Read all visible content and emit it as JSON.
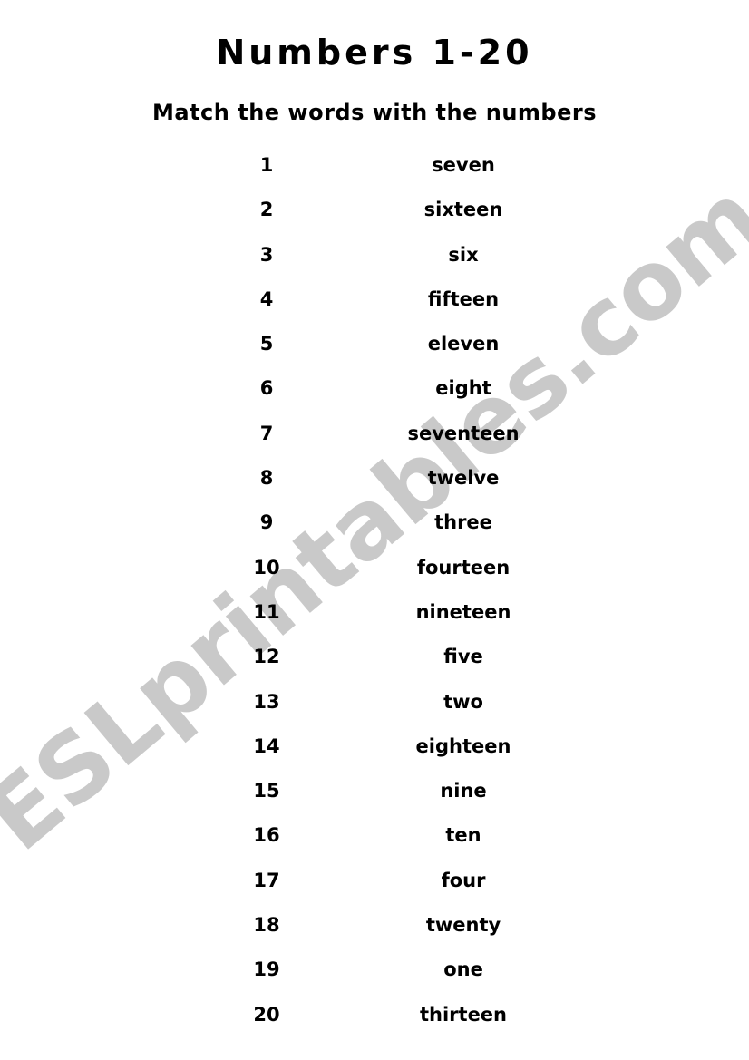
{
  "document": {
    "title": "Numbers 1-20",
    "subtitle": "Match the words with the numbers",
    "watermark": "ESLprintables.com",
    "numbers": [
      "1",
      "2",
      "3",
      "4",
      "5",
      "6",
      "7",
      "8",
      "9",
      "10",
      "11",
      "12",
      "13",
      "14",
      "15",
      "16",
      "17",
      "18",
      "19",
      "20"
    ],
    "words": [
      "seven",
      "sixteen",
      "six",
      "fifteen",
      "eleven",
      "eight",
      "seventeen",
      "twelve",
      "three",
      "fourteen",
      "nineteen",
      "five",
      "two",
      "eighteen",
      "nine",
      "ten",
      "four",
      "twenty",
      "one",
      "thirteen"
    ]
  }
}
